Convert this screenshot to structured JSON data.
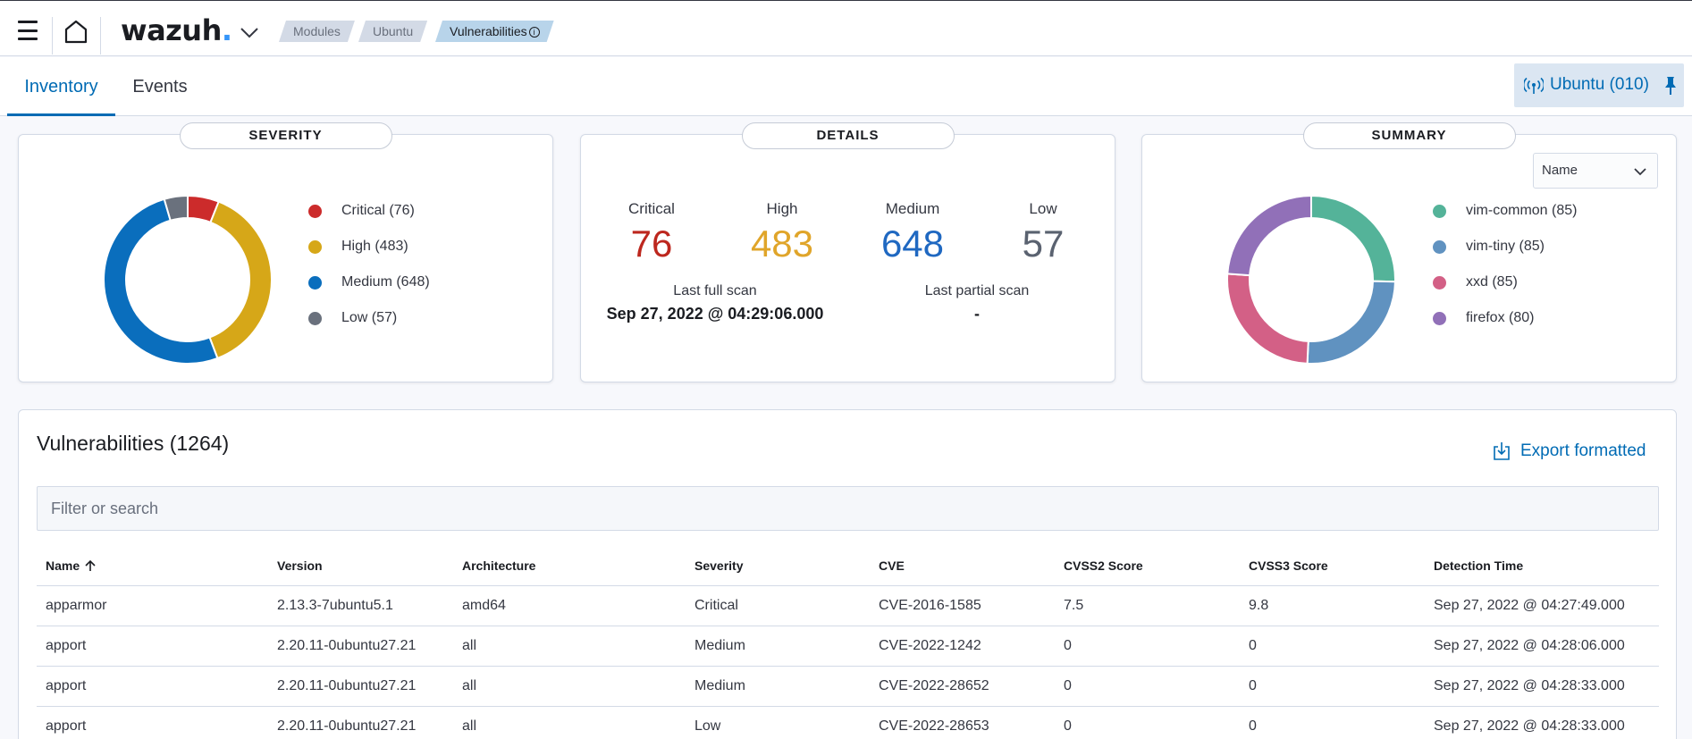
{
  "header": {
    "logo_text": "wazuh",
    "logo_dot": ".",
    "breadcrumbs": [
      {
        "label": "Modules"
      },
      {
        "label": "Ubuntu"
      },
      {
        "label": "Vulnerabilities"
      }
    ],
    "info_symbol": "i"
  },
  "tabs": [
    {
      "label": "Inventory",
      "active": true
    },
    {
      "label": "Events",
      "active": false
    }
  ],
  "agent_button": {
    "label": "Ubuntu (010)"
  },
  "severity_panel": {
    "title": "SEVERITY",
    "slices": [
      {
        "label": "Critical (76)",
        "value": 76,
        "color": "#cc2b2b"
      },
      {
        "label": "High (483)",
        "value": 483,
        "color": "#d6a718"
      },
      {
        "label": "Medium (648)",
        "value": 648,
        "color": "#0a6ebd"
      },
      {
        "label": "Low (57)",
        "value": 57,
        "color": "#6a717d"
      }
    ]
  },
  "details_panel": {
    "title": "DETAILS",
    "counts": [
      {
        "label": "Critical",
        "value": "76",
        "color": "#bd271e"
      },
      {
        "label": "High",
        "value": "483",
        "color": "#e0a52a"
      },
      {
        "label": "Medium",
        "value": "648",
        "color": "#1f68c1"
      },
      {
        "label": "Low",
        "value": "57",
        "color": "#5a6270"
      }
    ],
    "last_full_scan_label": "Last full scan",
    "last_full_scan_value": "Sep 27, 2022 @ 04:29:06.000",
    "last_partial_scan_label": "Last partial scan",
    "last_partial_scan_value": "-"
  },
  "summary_panel": {
    "title": "SUMMARY",
    "select_value": "Name",
    "slices": [
      {
        "label": "vim-common (85)",
        "value": 85,
        "color": "#54b399"
      },
      {
        "label": "vim-tiny (85)",
        "value": 85,
        "color": "#6092c0"
      },
      {
        "label": "xxd (85)",
        "value": 85,
        "color": "#d36086"
      },
      {
        "label": "firefox (80)",
        "value": 80,
        "color": "#9170b8"
      }
    ]
  },
  "vulnerabilities": {
    "title": "Vulnerabilities (1264)",
    "export_label": "Export formatted",
    "search_placeholder": "Filter or search",
    "columns": [
      "Name",
      "Version",
      "Architecture",
      "Severity",
      "CVE",
      "CVSS2 Score",
      "CVSS3 Score",
      "Detection Time"
    ],
    "rows": [
      [
        "apparmor",
        "2.13.3-7ubuntu5.1",
        "amd64",
        "Critical",
        "CVE-2016-1585",
        "7.5",
        "9.8",
        "Sep 27, 2022 @ 04:27:49.000"
      ],
      [
        "apport",
        "2.20.11-0ubuntu27.21",
        "all",
        "Medium",
        "CVE-2022-1242",
        "0",
        "0",
        "Sep 27, 2022 @ 04:28:06.000"
      ],
      [
        "apport",
        "2.20.11-0ubuntu27.21",
        "all",
        "Medium",
        "CVE-2022-28652",
        "0",
        "0",
        "Sep 27, 2022 @ 04:28:33.000"
      ],
      [
        "apport",
        "2.20.11-0ubuntu27.21",
        "all",
        "Low",
        "CVE-2022-28653",
        "0",
        "0",
        "Sep 27, 2022 @ 04:28:33.000"
      ]
    ]
  },
  "icons": {
    "menu": "hamburger-icon",
    "home": "home-icon",
    "dropdown": "chevron-down-icon",
    "agent": "antenna-icon",
    "pin": "pin-icon",
    "export": "download-icon",
    "sort": "arrow-up-icon"
  }
}
